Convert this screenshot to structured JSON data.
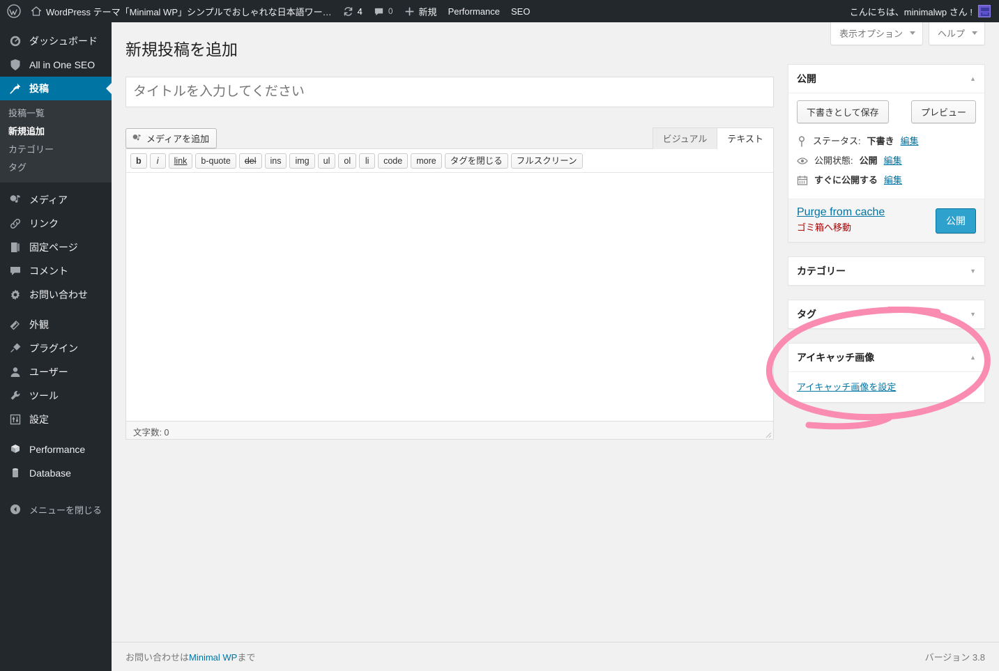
{
  "adminbar": {
    "logo_icon": "wordpress-logo-icon",
    "home_icon": "home-icon",
    "site_name": "WordPress テーマ「Minimal WP」シンプルでおしゃれな日本語ワー…",
    "updates_icon": "updates-icon",
    "updates_count": "4",
    "comments_icon": "comment-bubble-icon",
    "comments_count": "0",
    "new_icon": "plus-icon",
    "new_label": "新規",
    "performance_label": "Performance",
    "seo_label": "SEO",
    "greeting": "こんにちは、minimalwp さん !",
    "avatar_icon": "avatar-icon"
  },
  "sidebar": {
    "items": [
      {
        "label": "ダッシュボード",
        "icon": "dashboard-icon",
        "current": false
      },
      {
        "label": "All in One SEO",
        "icon": "shield-icon",
        "current": false
      },
      {
        "label": "投稿",
        "icon": "pin-icon",
        "current": true
      },
      {
        "label": "メディア",
        "icon": "media-icon",
        "current": false
      },
      {
        "label": "リンク",
        "icon": "link-icon",
        "current": false
      },
      {
        "label": "固定ページ",
        "icon": "page-icon",
        "current": false
      },
      {
        "label": "コメント",
        "icon": "comment-icon",
        "current": false
      },
      {
        "label": "お問い合わせ",
        "icon": "gear-icon",
        "current": false
      },
      {
        "label": "外観",
        "icon": "appearance-brush-icon",
        "current": false
      },
      {
        "label": "プラグイン",
        "icon": "plugin-plug-icon",
        "current": false
      },
      {
        "label": "ユーザー",
        "icon": "user-icon",
        "current": false
      },
      {
        "label": "ツール",
        "icon": "wrench-icon",
        "current": false
      },
      {
        "label": "設定",
        "icon": "settings-sliders-icon",
        "current": false
      },
      {
        "label": "Performance",
        "icon": "performance-cube-icon",
        "current": false
      },
      {
        "label": "Database",
        "icon": "database-cylinder-icon",
        "current": false
      }
    ],
    "submenu": [
      {
        "label": "投稿一覧",
        "current": false
      },
      {
        "label": "新規追加",
        "current": true
      },
      {
        "label": "カテゴリー",
        "current": false
      },
      {
        "label": "タグ",
        "current": false
      }
    ],
    "collapse_label": "メニューを閉じる",
    "collapse_icon": "collapse-arrow-icon"
  },
  "screen_meta": {
    "screen_options_label": "表示オプション",
    "help_label": "ヘルプ"
  },
  "main": {
    "page_title": "新規投稿を追加",
    "title_placeholder": "タイトルを入力してください",
    "add_media_label": "メディアを追加",
    "add_media_icon": "media-add-icon",
    "tabs": [
      {
        "label": "ビジュアル",
        "active": false
      },
      {
        "label": "テキスト",
        "active": true
      }
    ],
    "quicktags": [
      {
        "label": "b",
        "style": "bold"
      },
      {
        "label": "i",
        "style": "italic"
      },
      {
        "label": "link",
        "style": "underline"
      },
      {
        "label": "b-quote",
        "style": ""
      },
      {
        "label": "del",
        "style": "strike"
      },
      {
        "label": "ins",
        "style": ""
      },
      {
        "label": "img",
        "style": ""
      },
      {
        "label": "ul",
        "style": ""
      },
      {
        "label": "ol",
        "style": ""
      },
      {
        "label": "li",
        "style": ""
      },
      {
        "label": "code",
        "style": ""
      },
      {
        "label": "more",
        "style": ""
      },
      {
        "label": "タグを閉じる",
        "style": ""
      },
      {
        "label": "フルスクリーン",
        "style": ""
      }
    ],
    "editor_content": "",
    "word_count": "文字数: 0"
  },
  "publish_box": {
    "title": "公開",
    "toggle_icon": "triangle-up-icon",
    "save_draft_label": "下書きとして保存",
    "preview_label": "プレビュー",
    "status_icon": "pin-marker-icon",
    "status_label": "ステータス:",
    "status_value": "下書き",
    "status_edit": "編集",
    "visibility_icon": "eye-icon",
    "visibility_label": "公開状態:",
    "visibility_value": "公開",
    "visibility_edit": "編集",
    "schedule_icon": "calendar-icon",
    "schedule_label": "すぐに公開する",
    "schedule_edit": "編集",
    "purge_label": "Purge from cache",
    "trash_label": "ゴミ箱へ移動",
    "publish_label": "公開"
  },
  "boxes": [
    {
      "title": "カテゴリー",
      "toggle_icon": "triangle-down-icon",
      "open": false
    },
    {
      "title": "タグ",
      "toggle_icon": "triangle-down-icon",
      "open": false
    }
  ],
  "featured_box": {
    "title": "アイキャッチ画像",
    "toggle_icon": "triangle-up-icon",
    "set_link": "アイキャッチ画像を設定"
  },
  "footer": {
    "left_prefix": "お問い合わせは",
    "left_link": "Minimal WP",
    "left_suffix": "まで",
    "version": "バージョン 3.8"
  },
  "annotation": {
    "shape": "hand-drawn-pink-ellipse-with-tail",
    "color": "#f98cb0"
  },
  "colors": {
    "admin_blue": "#0074a2",
    "primary_button": "#2ea2cc",
    "sidebar_bg": "#23282d",
    "submenu_bg": "#32373c",
    "page_bg": "#f1f1f1",
    "annotation_pink": "#f98cb0"
  }
}
